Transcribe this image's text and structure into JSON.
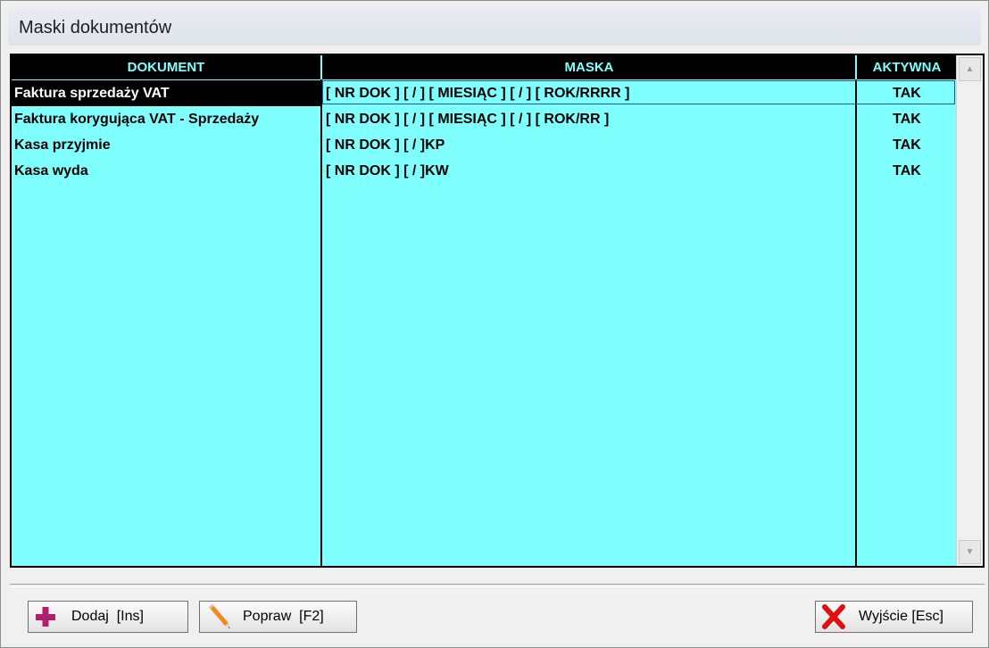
{
  "window": {
    "title": "Maski dokumentów"
  },
  "table": {
    "columns": [
      "DOKUMENT",
      "MASKA",
      "AKTYWNA"
    ],
    "rows": [
      {
        "dokument": "Faktura sprzedaży VAT",
        "maska": "[ NR DOK ] [ / ] [ MIESIĄC ] [ / ] [ ROK/RRRR ]",
        "aktywna": "TAK"
      },
      {
        "dokument": "Faktura korygująca VAT - Sprzedaży",
        "maska": "[ NR DOK ] [ / ] [ MIESIĄC ] [ / ] [ ROK/RR ]",
        "aktywna": "TAK"
      },
      {
        "dokument": "Kasa przyjmie",
        "maska": "[ NR DOK ] [ / ]KP",
        "aktywna": "TAK"
      },
      {
        "dokument": "Kasa wyda",
        "maska": "[ NR DOK ] [ / ]KW",
        "aktywna": "TAK"
      }
    ]
  },
  "buttons": {
    "add": "Dodaj  [Ins]",
    "edit": "Popraw  [F2]",
    "exit": "Wyjście [Esc]"
  },
  "colors": {
    "grid_bg": "#80ffff",
    "header_bg": "#000000",
    "header_text": "#80ffff",
    "add_icon": "#b0206a",
    "exit_icon": "#e01010"
  },
  "icons": {
    "add": "plus-icon",
    "edit": "pencil-icon",
    "exit": "x-icon",
    "scroll_up": "arrow-up-icon",
    "scroll_down": "arrow-down-icon"
  }
}
